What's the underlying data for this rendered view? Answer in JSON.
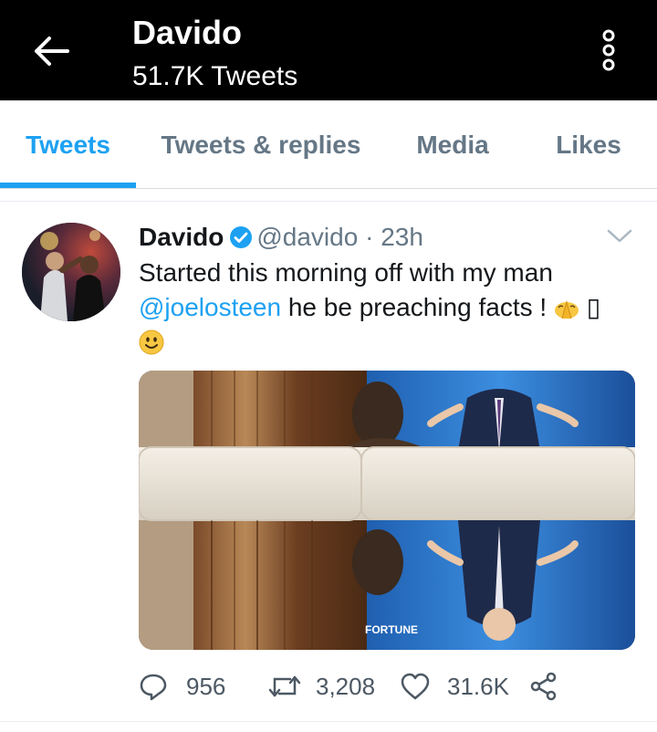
{
  "header": {
    "title": "Davido",
    "subtitle": "51.7K Tweets",
    "back_icon": "arrow-left-icon",
    "menu_icon": "more-vertical-icon"
  },
  "tabs": [
    {
      "label": "Tweets",
      "active": true
    },
    {
      "label": "Tweets & replies",
      "active": false
    },
    {
      "label": "Media",
      "active": false
    },
    {
      "label": "Likes",
      "active": false
    }
  ],
  "tweet": {
    "name": "Davido",
    "verified": true,
    "handle": "@davido",
    "separator": "·",
    "time": "23h",
    "text_before": "Started this morning off with my man",
    "mention": "@joelosteen",
    "text_after": "he be preaching facts !",
    "missing_glyph": "▯",
    "emojis": [
      "folded-hands-emoji",
      "smiling-face-emoji"
    ],
    "media_caption": "FORTUNE",
    "stats": {
      "replies": "956",
      "retweets": "3,208",
      "likes": "31.6K"
    }
  },
  "colors": {
    "accent": "#1da1f2",
    "topbar": "#000000",
    "muted": "#657786"
  }
}
